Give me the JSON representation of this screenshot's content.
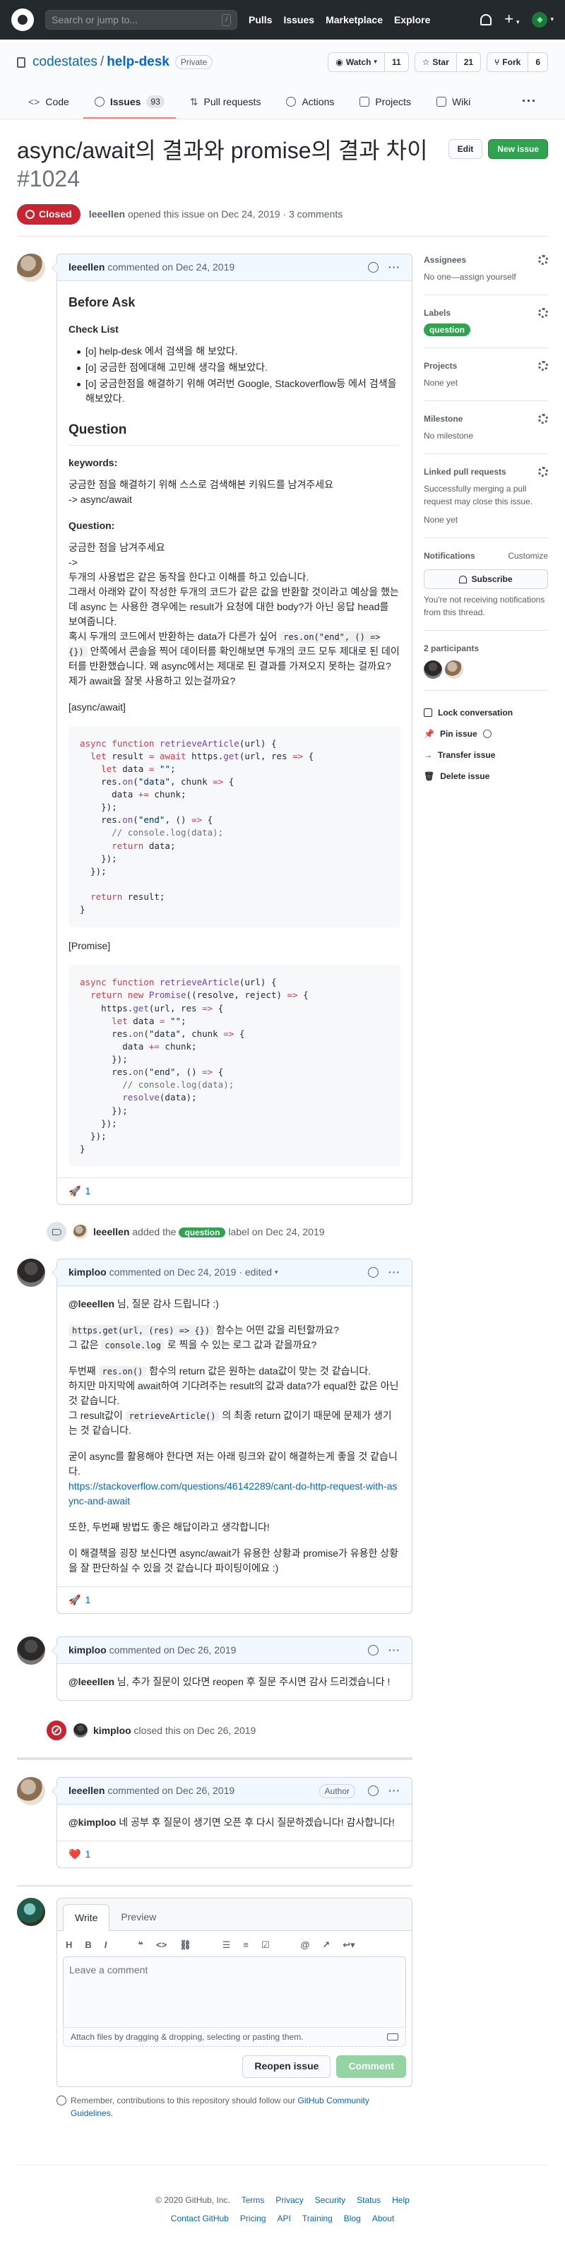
{
  "header": {
    "search_placeholder": "Search or jump to...",
    "slash": "/",
    "nav": [
      "Pulls",
      "Issues",
      "Marketplace",
      "Explore"
    ],
    "plus": "+"
  },
  "repo": {
    "owner": "codestates",
    "name": "help-desk",
    "visibility": "Private",
    "watch_label": "Watch",
    "watch_count": "11",
    "star_label": "Star",
    "star_count": "21",
    "fork_label": "Fork",
    "fork_count": "6",
    "tabs": [
      {
        "label": "Code"
      },
      {
        "label": "Issues",
        "count": "93"
      },
      {
        "label": "Pull requests"
      },
      {
        "label": "Actions"
      },
      {
        "label": "Projects"
      },
      {
        "label": "Wiki"
      }
    ],
    "more": "···"
  },
  "issue": {
    "title": "async/await의 결과와 promise의 결과 차이",
    "number": "#1024",
    "edit_label": "Edit",
    "new_issue_label": "New issue",
    "state": "Closed",
    "author": "leeellen",
    "meta_text": " opened this issue on Dec 24, 2019 · 3 comments"
  },
  "comments": [
    {
      "author": "leeellen",
      "header_text": "commented on Dec 24, 2019",
      "body": {
        "h_before": "Before Ask",
        "checklist_title": "Check List",
        "checklist": [
          "[o] help-desk 에서 검색을 해 보았다.",
          "[o] 궁금한 점에대해 고민해 생각을 해보았다.",
          "[o] 궁금한점을 해결하기 위해 여러번 Google, Stackoverflow등 에서 검색을 해보았다."
        ],
        "h_question": "Question",
        "keywords_title": "keywords:",
        "keywords_lines": [
          "궁금한 점을 해결하기 위해 스스로 검색해본 키워드를 남겨주세요",
          "-> async/await"
        ],
        "question_title": "Question:",
        "q_lines1": [
          "궁금한 점을 남겨주세요",
          "->"
        ],
        "q_lines2": [
          "두개의 사용법은 같은 동작을 한다고 이해를 하고 있습니다.",
          "그래서 아래와 같이 작성한 두개의 코드가 같은 값을 반환할 것이라고 예상을 했는데 async 는 사용한 경우에는 result가 요청에 대한 body?가 아닌 응답 head를 보여줍니다."
        ],
        "q_p3_a": "혹시 두개의 코드에서 반환하는 data가 다른가 싶어 ",
        "q_p3_code": "res.on(\"end\", () => {})",
        "q_p3_b": " 안쪽에서 콘솔을 찍어 데이터를 확인해보면 두개의 코드 모두 제대로 된 데이터를 반환했습니다. 왜 async에서는 제대로 된 결과를 가져오지 못하는 걸까요? 제가 await을 잘못 사용하고 있는걸까요?",
        "label_async": "[async/await]",
        "label_promise": "[Promise]"
      },
      "reaction_emoji": "🚀",
      "reaction_count": "1"
    },
    {
      "author": "kimploo",
      "header_text": "commented on Dec 24, 2019 · edited",
      "body": {
        "mention": "@leeellen",
        "greet": " 님, 질문 감사 드립니다 :)",
        "p2_code": "https.get(url, (res) => {})",
        "p2_a": " 함수는 어떤 값을 리턴할까요?",
        "p2_b1": "그 값은 ",
        "p2_code2": "console.log",
        "p2_b2": " 로 찍을 수 있는 로그 값과 같을까요?",
        "p3_a1": "두번째 ",
        "p3_code": "res.on()",
        "p3_a2": " 함수의 return 값은 원하는 data값이 맞는 것 같습니다.",
        "p3_b": "하지만 마지막에 await하여 기다려주는 result의 값과 data?가 equal한 값은 아닌 것 같습니다.",
        "p3_c1": "그 result값이 ",
        "p3_code2": "retrieveArticle()",
        "p3_c2": " 의 최종 return 값이기 때문에 문제가 생기는 것 같습니다.",
        "p4": "굳이 async를 활용해야 한다면 저는 아래 링크와 같이 해결하는게 좋을 것 같습니다.",
        "link": "https://stackoverflow.com/questions/46142289/cant-do-http-request-with-async-and-await",
        "p5": "또한, 두번째 방법도 좋은 해답이라고 생각합니다!",
        "p6": "이 해결책을 굉장 보신다면 async/await가 유용한 상황과 promise가 유용한 상황을 잘 판단하실 수 있을 것 같습니다 파이팅이에요 :)"
      },
      "reaction_emoji": "🚀",
      "reaction_count": "1"
    },
    {
      "author": "kimploo",
      "header_text": "commented on Dec 26, 2019",
      "body": {
        "mention": "@leeellen",
        "text": " 님, 추가 질문이 있다면 reopen 후 질문 주시면 감사 드리겠습니다 !"
      }
    },
    {
      "author": "leeellen",
      "header_text": "commented on Dec 26, 2019",
      "tag": "Author",
      "body": {
        "mention": "@kimploo",
        "text": " 네 공부 후 질문이 생기면 오픈 후 다시 질문하겠습니다! 감사합니다!"
      },
      "reaction_emoji": "❤️",
      "reaction_count": "1"
    }
  ],
  "events": {
    "label_actor": "leeellen",
    "label_text_a": " added the ",
    "label_name": "question",
    "label_text_b": " label on Dec 24, 2019",
    "close_actor": "kimploo",
    "close_text": " closed this on Dec 26, 2019"
  },
  "composer": {
    "tab_write": "Write",
    "tab_preview": "Preview",
    "placeholder": "Leave a comment",
    "attach_text": "Attach files by dragging & dropping, selecting or pasting them.",
    "reopen_label": "Reopen issue",
    "comment_label": "Comment",
    "reminder_a": "Remember, contributions to this repository should follow our ",
    "reminder_link": "GitHub Community Guidelines",
    "reminder_b": "."
  },
  "sidebar": {
    "assignees_title": "Assignees",
    "assignees_value": "No one—assign yourself",
    "labels_title": "Labels",
    "label_value": "question",
    "projects_title": "Projects",
    "projects_value": "None yet",
    "milestone_title": "Milestone",
    "milestone_value": "No milestone",
    "linked_title": "Linked pull requests",
    "linked_desc": "Successfully merging a pull request may close this issue.",
    "linked_value": "None yet",
    "notif_title": "Notifications",
    "notif_customize": "Customize",
    "subscribe_label": "Subscribe",
    "notif_desc": "You're not receiving notifications from this thread.",
    "participants_title": "2 participants",
    "lock": "Lock conversation",
    "pin": "Pin issue",
    "transfer": "Transfer issue",
    "delete": "Delete issue"
  },
  "footer": {
    "row1": [
      "© 2020 GitHub, Inc.",
      "Terms",
      "Privacy",
      "Security",
      "Status",
      "Help"
    ],
    "row2": [
      "Contact GitHub",
      "Pricing",
      "API",
      "Training",
      "Blog",
      "About"
    ]
  },
  "colors": {
    "header_bg": "#24292e",
    "link": "#0366d6",
    "closed": "#cb2431",
    "green": "#2ea44f",
    "tab_accent": "#f9826c"
  }
}
